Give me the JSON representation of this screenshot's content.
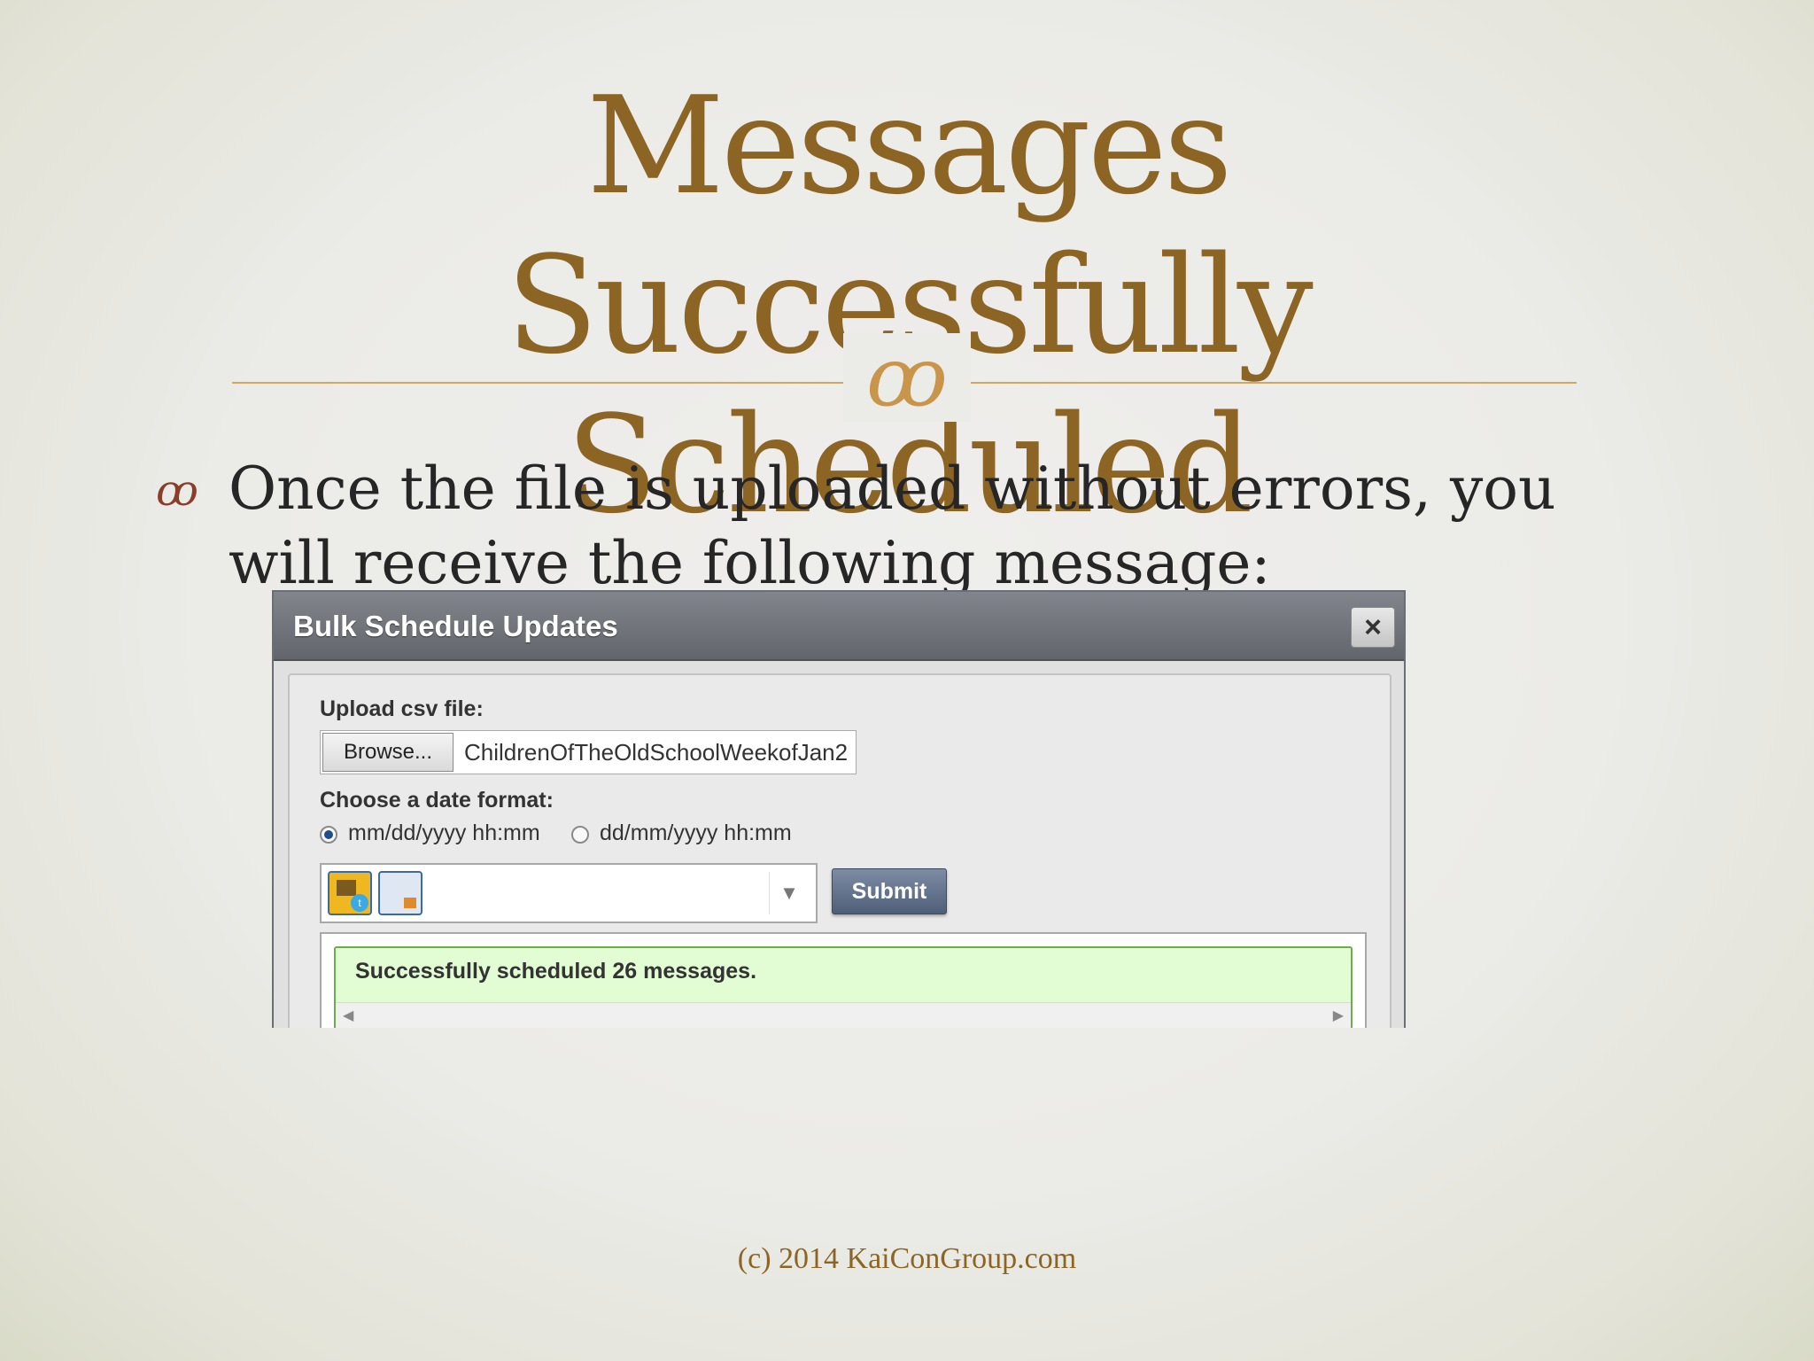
{
  "slide": {
    "title_line1": "Messages Successfully",
    "title_line2": "Scheduled",
    "flourish": "ꝏ",
    "bullet_mark": "ꝏ",
    "bullet_text": "Once the file is uploaded without errors, you will receive the following message:",
    "footer": "(c) 2014 KaiConGroup.com"
  },
  "dialog": {
    "title": "Bulk Schedule Updates",
    "close_label": "×",
    "upload_label": "Upload csv file:",
    "browse_label": "Browse...",
    "file_name": "ChildrenOfTheOldSchoolWeekofJan2",
    "date_format_label": "Choose a date format:",
    "date_formats": [
      {
        "label": "mm/dd/yyyy hh:mm",
        "selected": true
      },
      {
        "label": "dd/mm/yyyy hh:mm",
        "selected": false
      }
    ],
    "profiles": [
      {
        "icon": "twitter-profile-icon"
      },
      {
        "icon": "facebook-profile-icon"
      }
    ],
    "dropdown_icon": "chevron-down-icon",
    "submit_label": "Submit",
    "result_message": "Successfully scheduled 26 messages."
  },
  "colors": {
    "title": "#8c6524",
    "accent_rule": "#d2a860",
    "success_bg": "#e2fcd4",
    "success_border": "#6aad4c",
    "dialog_header": "#6f7379"
  }
}
